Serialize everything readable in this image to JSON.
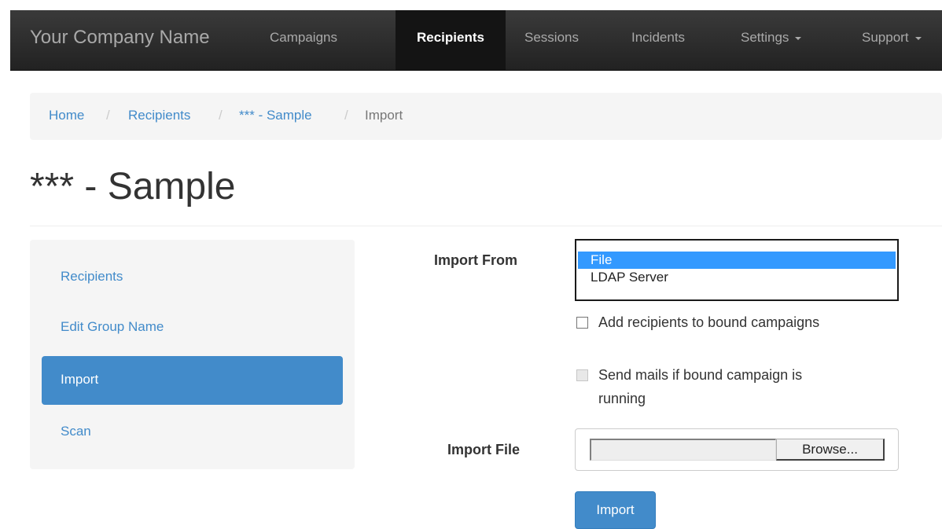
{
  "navbar": {
    "brand": "Your Company Name",
    "items": [
      {
        "label": "Campaigns",
        "active": false
      },
      {
        "label": "Recipients",
        "active": true
      },
      {
        "label": "Sessions",
        "active": false
      },
      {
        "label": "Incidents",
        "active": false
      },
      {
        "label": "Settings",
        "dropdown": true
      },
      {
        "label": "Support",
        "dropdown": true
      }
    ]
  },
  "breadcrumb": {
    "items": [
      "Home",
      "Recipients",
      "*** - Sample",
      "Import"
    ],
    "separator": "/"
  },
  "page": {
    "title": "*** - Sample"
  },
  "sidebar": {
    "items": [
      {
        "label": "Recipients",
        "active": false
      },
      {
        "label": "Edit Group Name",
        "active": false
      },
      {
        "label": "Import",
        "active": true
      },
      {
        "label": "Scan",
        "active": false
      }
    ]
  },
  "form": {
    "import_from_label": "Import From",
    "import_from_options": [
      "File",
      "LDAP Server"
    ],
    "import_from_selected": "File",
    "add_recipients_label": "Add recipients to bound campaigns",
    "add_recipients_checked": false,
    "send_mails_label_line1": "Send mails if bound campaign is",
    "send_mails_label_line2": "running",
    "send_mails_checked": false,
    "send_mails_disabled": true,
    "import_file_label": "Import File",
    "file_value": "",
    "browse_label": "Browse...",
    "submit_label": "Import"
  },
  "colors": {
    "navbar_bg": "#222222",
    "link": "#428bca",
    "primary": "#428bca",
    "selected_option": "#3399ff"
  }
}
